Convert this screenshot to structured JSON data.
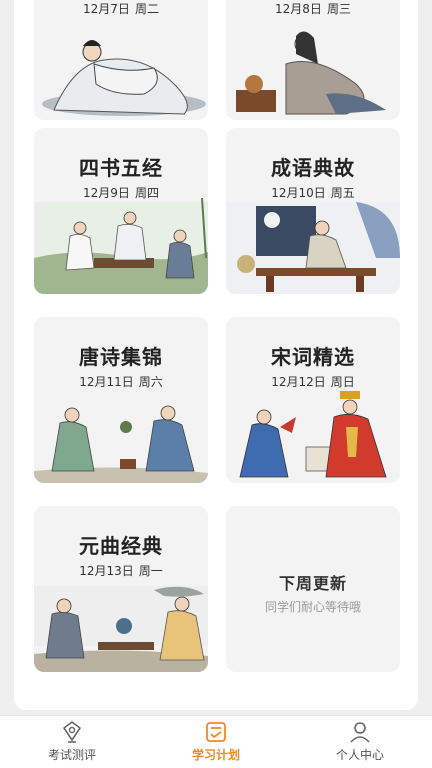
{
  "cards": [
    {
      "title": "",
      "date": "12月7日",
      "weekday": "周二"
    },
    {
      "title": "",
      "date": "12月8日",
      "weekday": "周三"
    },
    {
      "title": "四书五经",
      "date": "12月9日",
      "weekday": "周四"
    },
    {
      "title": "成语典故",
      "date": "12月10日",
      "weekday": "周五"
    },
    {
      "title": "唐诗集锦",
      "date": "12月11日",
      "weekday": "周六"
    },
    {
      "title": "宋词精选",
      "date": "12月12日",
      "weekday": "周日"
    },
    {
      "title": "元曲经典",
      "date": "12月13日",
      "weekday": "周一"
    }
  ],
  "upcoming": {
    "title": "下周更新",
    "subtitle": "同学们耐心等待哦"
  },
  "tabs": [
    {
      "label": "考试测评",
      "icon": "badge-icon",
      "active": false
    },
    {
      "label": "学习计划",
      "icon": "plan-icon",
      "active": true
    },
    {
      "label": "个人中心",
      "icon": "person-icon",
      "active": false
    }
  ],
  "colors": {
    "accent": "#f08a1c"
  }
}
